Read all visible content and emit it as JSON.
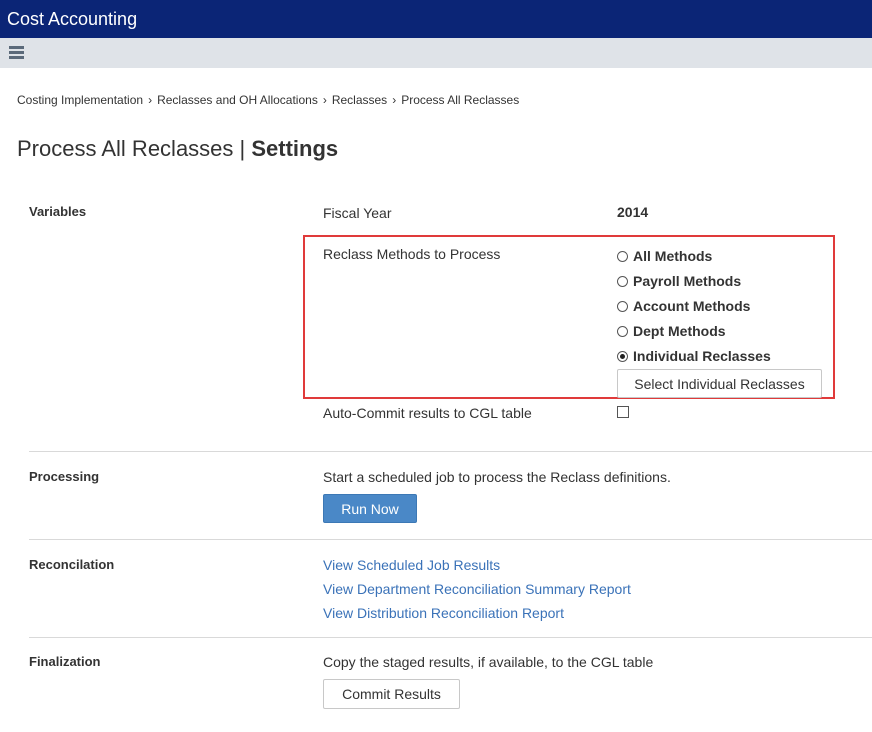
{
  "app": {
    "title": "Cost Accounting"
  },
  "breadcrumb": {
    "items": [
      "Costing Implementation",
      "Reclasses and OH Allocations",
      "Reclasses",
      "Process All Reclasses"
    ],
    "separator": "›"
  },
  "page": {
    "title_prefix": "Process All Reclasses |",
    "title_suffix": "Settings"
  },
  "variables": {
    "section_label": "Variables",
    "fiscal_year_label": "Fiscal Year",
    "fiscal_year_value": "2014",
    "reclass_methods_label": "Reclass Methods to Process",
    "options": [
      {
        "label": "All Methods",
        "selected": false
      },
      {
        "label": "Payroll Methods",
        "selected": false
      },
      {
        "label": "Account Methods",
        "selected": false
      },
      {
        "label": "Dept Methods",
        "selected": false
      },
      {
        "label": "Individual Reclasses",
        "selected": true
      }
    ],
    "select_button_label": "Select Individual Reclasses",
    "auto_commit_label": "Auto-Commit results to CGL table",
    "auto_commit_checked": false
  },
  "processing": {
    "section_label": "Processing",
    "description": "Start a scheduled job to process the Reclass definitions.",
    "run_button_label": "Run Now"
  },
  "reconciliation": {
    "section_label": "Reconcilation",
    "links": [
      "View Scheduled Job Results",
      "View Department Reconciliation Summary Report",
      "View Distribution Reconciliation Report"
    ]
  },
  "finalization": {
    "section_label": "Finalization",
    "description": "Copy the staged results, if available, to the CGL table",
    "commit_button_label": "Commit Results"
  },
  "colors": {
    "header_bg": "#0b2576",
    "subbar_bg": "#dfe3e8",
    "primary_button": "#4a88c7",
    "link": "#3a72b8",
    "highlight_border": "#e03a3a"
  }
}
